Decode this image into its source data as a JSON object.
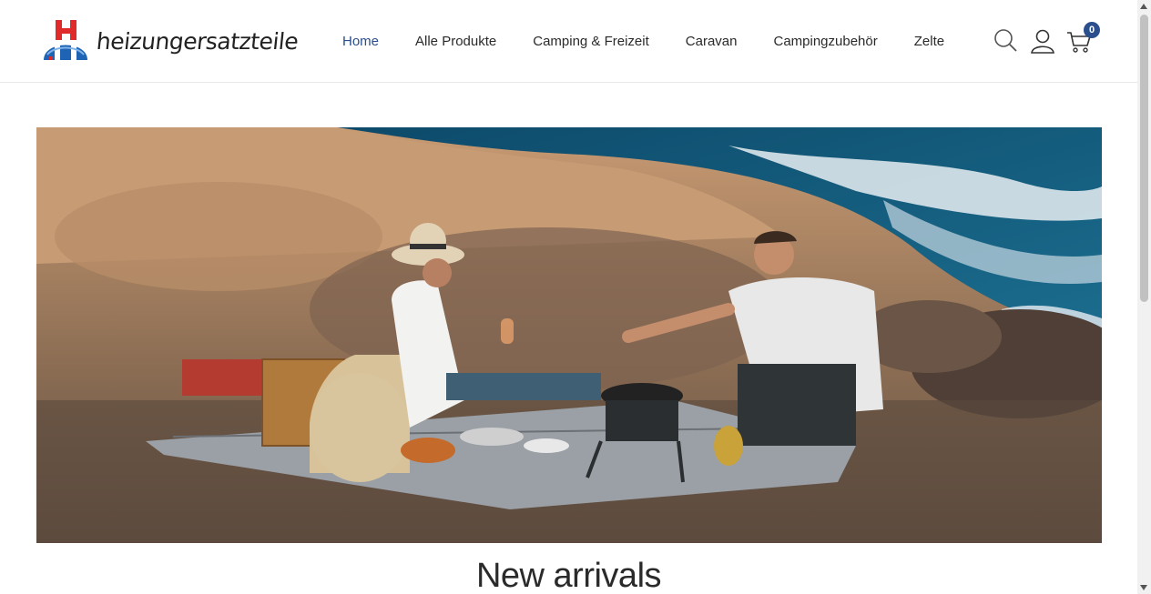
{
  "brand": {
    "name": "heizungersatzteile",
    "colors": {
      "red": "#e02b2b",
      "blue": "#1f63b4",
      "accent": "#2a4f8c"
    }
  },
  "nav": {
    "items": [
      {
        "label": "Home",
        "active": true
      },
      {
        "label": "Alle Produkte"
      },
      {
        "label": "Camping & Freizeit"
      },
      {
        "label": "Caravan"
      },
      {
        "label": "Campingzubehör"
      },
      {
        "label": "Zelte"
      }
    ]
  },
  "header_icons": {
    "search": "search-icon",
    "account": "user-icon",
    "cart": "cart-icon",
    "cart_count": "0"
  },
  "hero": {
    "image": "couple-picnic-on-rocks-by-sea"
  },
  "section": {
    "title": "New arrivals"
  }
}
